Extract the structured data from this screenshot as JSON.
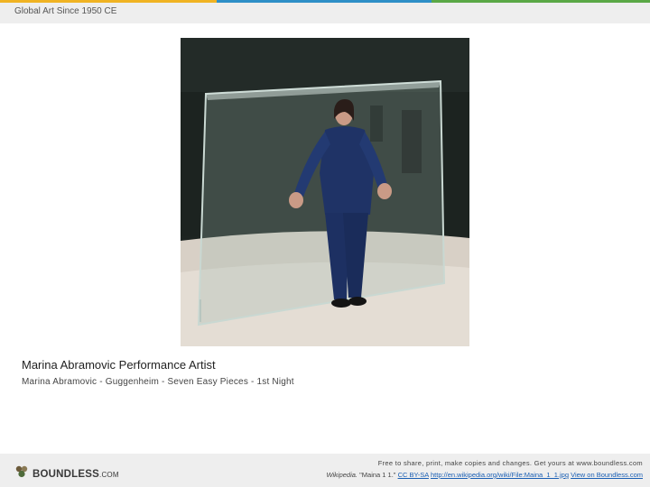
{
  "header": {
    "title": "Global Art Since 1950 CE",
    "stripe_colors": [
      "#f0b323",
      "#2e8fc7",
      "#5aa846"
    ]
  },
  "slide": {
    "image_alt": "Marina Abramovic standing behind a glass pane in a gallery",
    "caption_title": "Marina Abramovic Performance Artist",
    "caption_subtitle": "Marina Abramovic - Guggenheim - Seven Easy Pieces - 1st Night"
  },
  "footer": {
    "logo_text": "BOUNDLESS",
    "logo_suffix": ".COM",
    "line1": "Free to share, print, make copies and changes. Get yours at www.boundless.com",
    "source": "Wikipedia.",
    "attribution": "\"Maina 1 1.\"",
    "license_link": "CC BY-SA",
    "url_link": "http://en.wikipedia.org/wiki/File:Maina_1_1.jpg",
    "view_link": "View on Boundless.com"
  }
}
